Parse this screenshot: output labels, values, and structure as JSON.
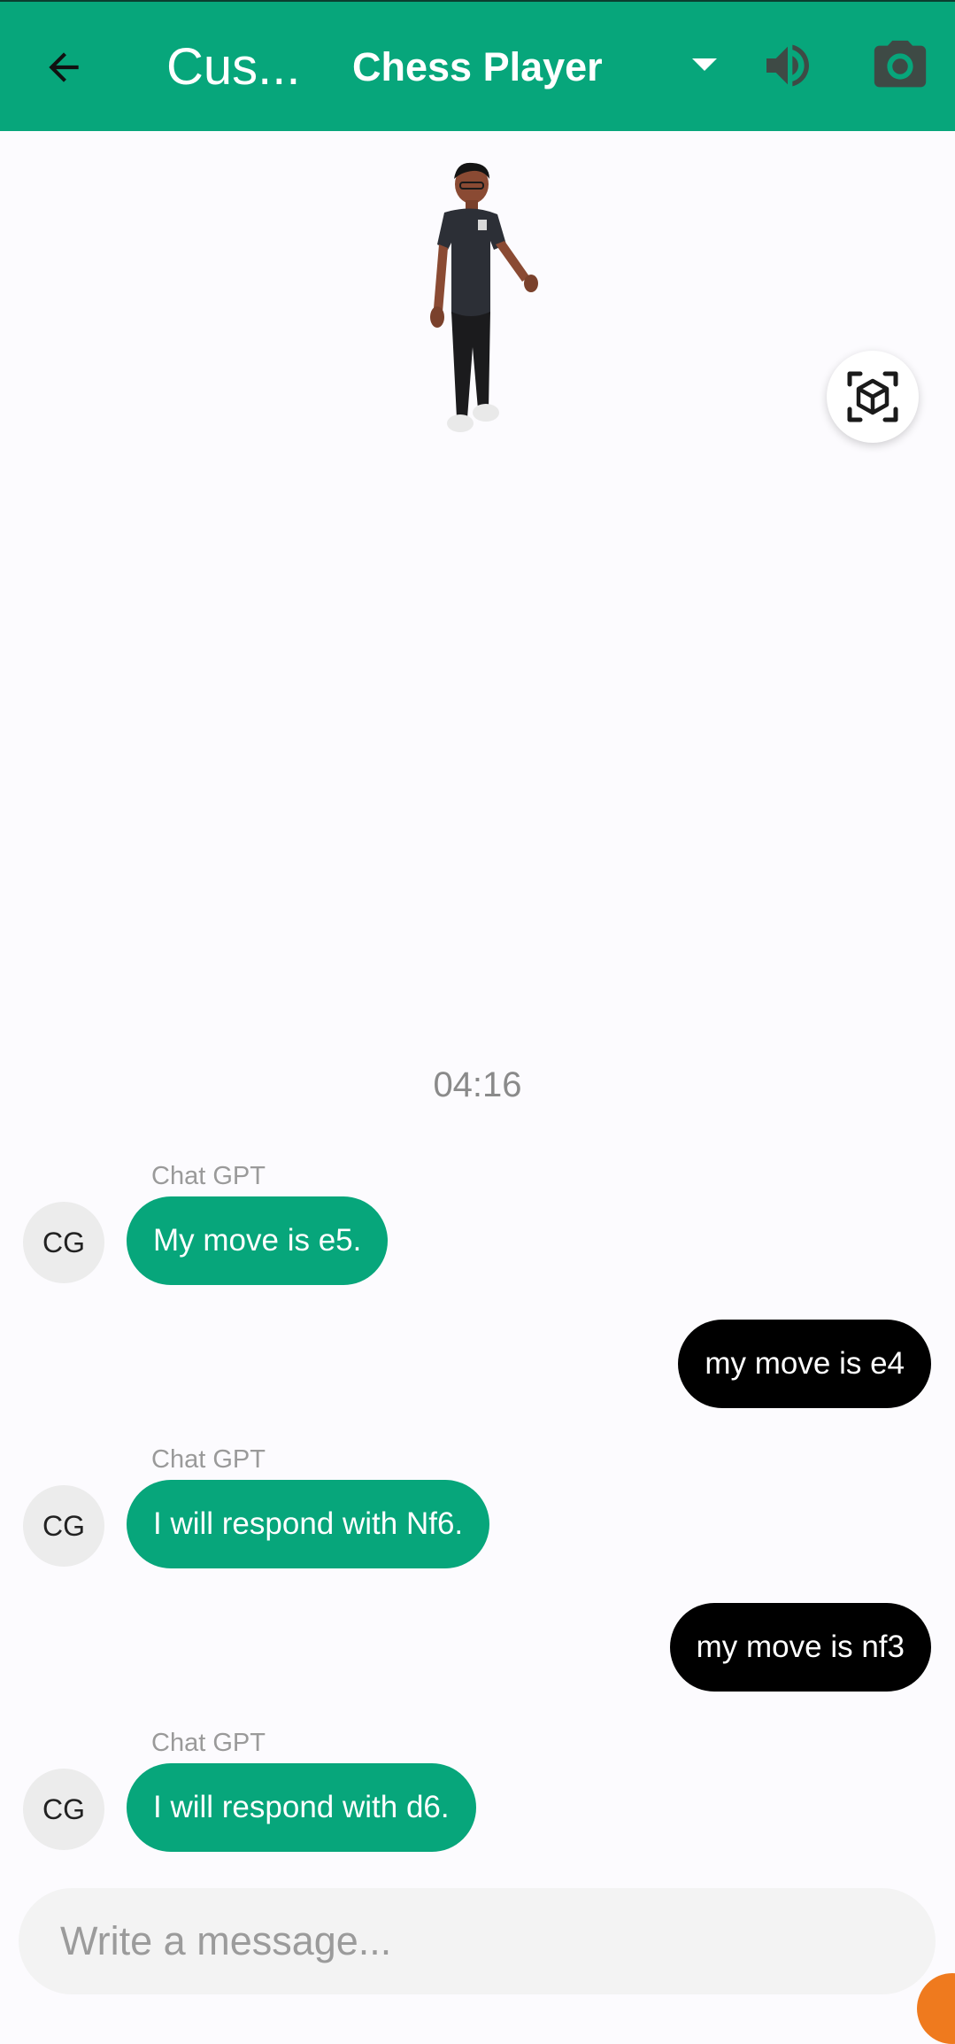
{
  "appbar": {
    "title": "Cus...",
    "persona": "Chess Player",
    "bg_color": "#07a67b"
  },
  "icons": {
    "back": "back-arrow-icon",
    "dropdown": "dropdown-arrow-icon",
    "volume": "volume-icon",
    "camera": "camera-icon",
    "ar_view": "3d-cube-icon"
  },
  "chat": {
    "timestamp": "04:16",
    "messages": [
      {
        "from": "bot",
        "sender": "Chat GPT",
        "initials": "CG",
        "text": "My move is e5."
      },
      {
        "from": "user",
        "text": "my move is e4"
      },
      {
        "from": "bot",
        "sender": "Chat GPT",
        "initials": "CG",
        "text": "I will respond with Nf6."
      },
      {
        "from": "user",
        "text": "my move is nf3"
      },
      {
        "from": "bot",
        "sender": "Chat GPT",
        "initials": "CG",
        "text": "I will respond with d6."
      }
    ]
  },
  "composer": {
    "placeholder": "Write a message...",
    "value": ""
  },
  "colors": {
    "bot_bubble": "#07a67b",
    "user_bubble": "#000000",
    "background": "#fcfbfe"
  }
}
